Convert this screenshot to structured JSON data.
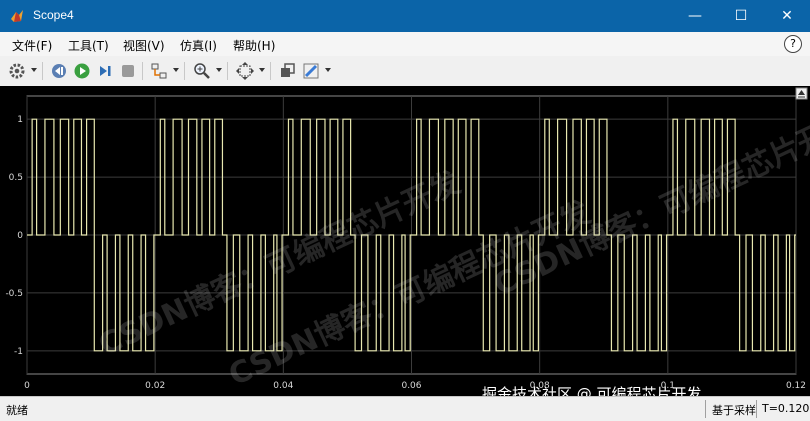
{
  "window": {
    "title": "Scope4",
    "minimize": "—",
    "maximize": "☐",
    "close": "✕"
  },
  "menu": [
    "文件(F)",
    "工具(T)",
    "视图(V)",
    "仿真(I)",
    "帮助(H)"
  ],
  "help_badge": "?",
  "toolbar_icons": [
    "gear-icon",
    "step-back-icon",
    "run-icon",
    "step-forward-icon",
    "stop-icon",
    "highlight-block-icon",
    "zoom-in-icon",
    "fit-axes-icon",
    "layout-icon",
    "style-icon"
  ],
  "chart_data": {
    "type": "line",
    "title": "",
    "xlabel": "",
    "ylabel": "",
    "xlim": [
      0,
      0.12
    ],
    "ylim": [
      -1.2,
      1.2
    ],
    "xticks": [
      "0",
      "0.02",
      "0.04",
      "0.06",
      "0.08",
      "0.1",
      "0.12"
    ],
    "yticks": [
      "1",
      "0.5",
      "0",
      "-0.5",
      "-1"
    ],
    "grid": true,
    "series": [
      {
        "color": "#e8e8b0",
        "description_of_shape": "three-level PWM pulse train, period 0.02 s; positive pulses (value 1) in first half-cycle, negative pulses (value -1) in second half-cycle",
        "pulses": [
          {
            "start": 0.0008,
            "end": 0.0015,
            "v": 1
          },
          {
            "start": 0.0028,
            "end": 0.0042,
            "v": 1
          },
          {
            "start": 0.0052,
            "end": 0.0065,
            "v": 1
          },
          {
            "start": 0.0073,
            "end": 0.0085,
            "v": 1
          },
          {
            "start": 0.0093,
            "end": 0.0105,
            "v": 1
          },
          {
            "start": 0.0105,
            "end": 0.0118,
            "v": -1
          },
          {
            "start": 0.0125,
            "end": 0.0138,
            "v": -1
          },
          {
            "start": 0.0145,
            "end": 0.0158,
            "v": -1
          },
          {
            "start": 0.0165,
            "end": 0.0178,
            "v": -1
          },
          {
            "start": 0.0185,
            "end": 0.0198,
            "v": -1
          },
          {
            "start": 0.0208,
            "end": 0.0215,
            "v": 1
          },
          {
            "start": 0.0228,
            "end": 0.0242,
            "v": 1
          },
          {
            "start": 0.0252,
            "end": 0.0265,
            "v": 1
          },
          {
            "start": 0.0273,
            "end": 0.0285,
            "v": 1
          },
          {
            "start": 0.0293,
            "end": 0.0305,
            "v": 1
          },
          {
            "start": 0.0312,
            "end": 0.0322,
            "v": -1
          },
          {
            "start": 0.0332,
            "end": 0.0345,
            "v": -1
          },
          {
            "start": 0.0352,
            "end": 0.0365,
            "v": -1
          },
          {
            "start": 0.0372,
            "end": 0.0385,
            "v": -1
          },
          {
            "start": 0.039,
            "end": 0.0398,
            "v": -1
          },
          {
            "start": 0.0408,
            "end": 0.0415,
            "v": 1
          },
          {
            "start": 0.0428,
            "end": 0.0442,
            "v": 1
          },
          {
            "start": 0.0452,
            "end": 0.0465,
            "v": 1
          },
          {
            "start": 0.0473,
            "end": 0.0485,
            "v": 1
          },
          {
            "start": 0.0493,
            "end": 0.0505,
            "v": 1
          },
          {
            "start": 0.0512,
            "end": 0.0522,
            "v": -1
          },
          {
            "start": 0.0532,
            "end": 0.0545,
            "v": -1
          },
          {
            "start": 0.0552,
            "end": 0.0565,
            "v": -1
          },
          {
            "start": 0.0572,
            "end": 0.0585,
            "v": -1
          },
          {
            "start": 0.059,
            "end": 0.0598,
            "v": -1
          },
          {
            "start": 0.0608,
            "end": 0.0615,
            "v": 1
          },
          {
            "start": 0.0628,
            "end": 0.0642,
            "v": 1
          },
          {
            "start": 0.0652,
            "end": 0.0665,
            "v": 1
          },
          {
            "start": 0.0673,
            "end": 0.0685,
            "v": 1
          },
          {
            "start": 0.0693,
            "end": 0.0705,
            "v": 1
          },
          {
            "start": 0.0712,
            "end": 0.0722,
            "v": -1
          },
          {
            "start": 0.0732,
            "end": 0.0745,
            "v": -1
          },
          {
            "start": 0.0752,
            "end": 0.0765,
            "v": -1
          },
          {
            "start": 0.0772,
            "end": 0.0785,
            "v": -1
          },
          {
            "start": 0.079,
            "end": 0.0798,
            "v": -1
          },
          {
            "start": 0.0808,
            "end": 0.0815,
            "v": 1
          },
          {
            "start": 0.0828,
            "end": 0.0842,
            "v": 1
          },
          {
            "start": 0.0852,
            "end": 0.0865,
            "v": 1
          },
          {
            "start": 0.0873,
            "end": 0.0885,
            "v": 1
          },
          {
            "start": 0.0893,
            "end": 0.0905,
            "v": 1
          },
          {
            "start": 0.0912,
            "end": 0.0922,
            "v": -1
          },
          {
            "start": 0.0932,
            "end": 0.0945,
            "v": -1
          },
          {
            "start": 0.0952,
            "end": 0.0965,
            "v": -1
          },
          {
            "start": 0.0972,
            "end": 0.0985,
            "v": -1
          },
          {
            "start": 0.099,
            "end": 0.0998,
            "v": -1
          },
          {
            "start": 0.1008,
            "end": 0.1015,
            "v": 1
          },
          {
            "start": 0.1028,
            "end": 0.1042,
            "v": 1
          },
          {
            "start": 0.1052,
            "end": 0.1065,
            "v": 1
          },
          {
            "start": 0.1073,
            "end": 0.1085,
            "v": 1
          },
          {
            "start": 0.1093,
            "end": 0.1105,
            "v": 1
          },
          {
            "start": 0.1112,
            "end": 0.1122,
            "v": -1
          },
          {
            "start": 0.1132,
            "end": 0.1145,
            "v": -1
          },
          {
            "start": 0.1152,
            "end": 0.1165,
            "v": -1
          },
          {
            "start": 0.1172,
            "end": 0.1185,
            "v": -1
          },
          {
            "start": 0.119,
            "end": 0.1198,
            "v": -1
          }
        ]
      }
    ]
  },
  "watermarks": [
    "CSDN博客：可编程芯片开发",
    "CSDN博客：可编程芯片开发",
    "CSDN博客：可编程芯片开发"
  ],
  "watermark_bottom": "掘金技术社区 @ 可编程芯片开发",
  "status": {
    "left": "就绪",
    "mid": "基于采样",
    "right": "T=0.120"
  }
}
